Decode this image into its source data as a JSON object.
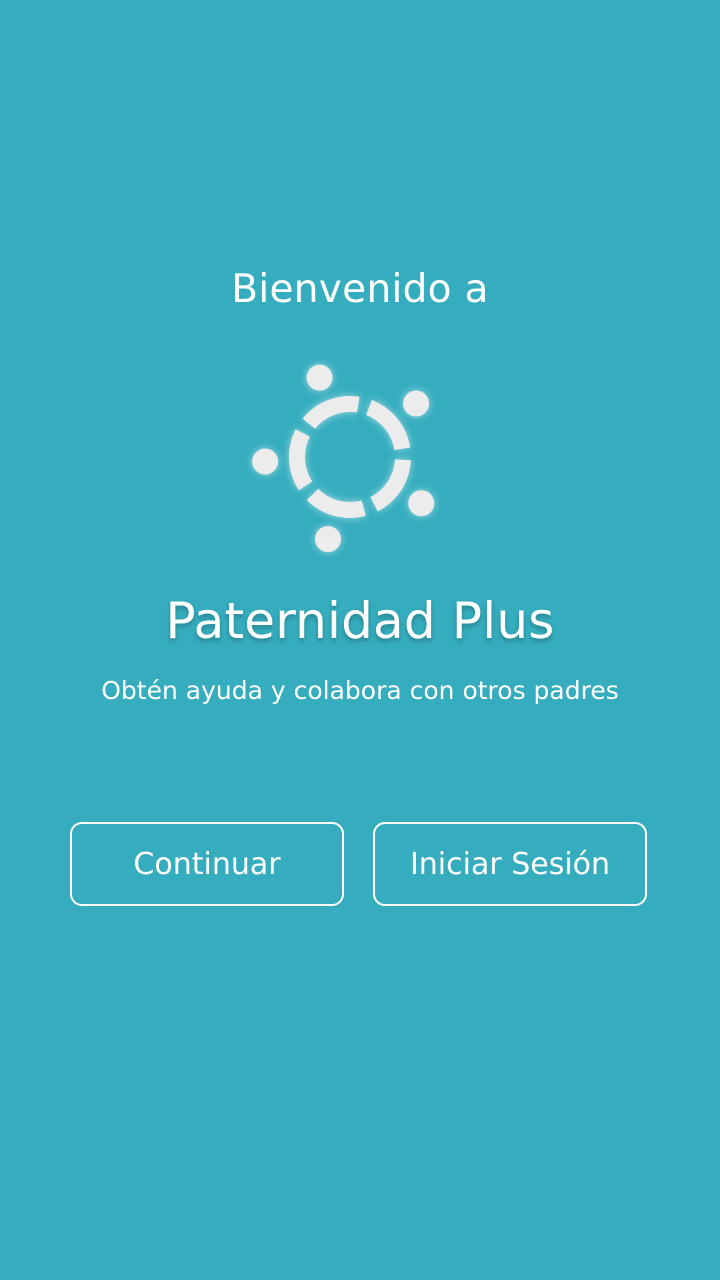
{
  "welcome": {
    "heading": "Bienvenido a",
    "logo_icon": "community-circle-icon",
    "app_name": "Paternidad Plus",
    "tagline": "Obtén ayuda y colabora con otros padres"
  },
  "actions": {
    "continue_label": "Continuar",
    "login_label": "Iniciar Sesión"
  },
  "colors": {
    "background": "#35adbe",
    "foreground": "#ffffff",
    "logo_fill": "#ececec"
  }
}
